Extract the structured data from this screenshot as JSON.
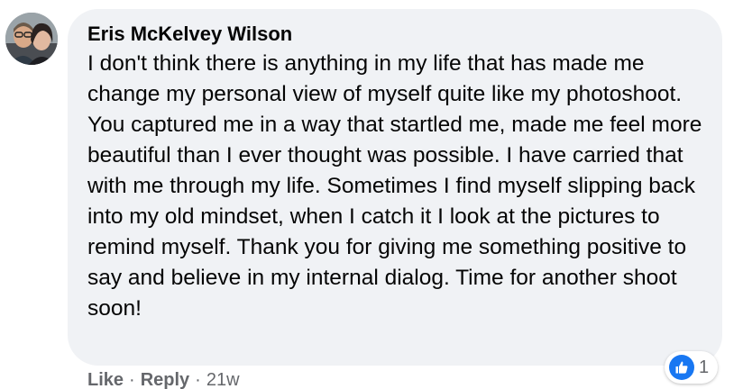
{
  "comment": {
    "author": "Eris McKelvey Wilson",
    "text": "I don't think there is anything in my life that has made me change my personal view of myself quite like my photoshoot. You captured me in a way that startled me, made me feel more beautiful than I ever thought was possible. I have carried that with me through my life. Sometimes I find myself slipping back into my old mindset, when I catch it I look at the pictures to remind myself. Thank you for giving me something positive to say and believe in my internal dialog. Time for another shoot soon!",
    "actions": {
      "like_label": "Like",
      "reply_label": "Reply",
      "separator": "·",
      "timestamp": "21w"
    },
    "reactions": {
      "icon": "thumbs-up-icon",
      "count": "1",
      "color": "#1877f2"
    }
  },
  "colors": {
    "bubble": "#f0f2f5",
    "text": "#050505",
    "secondary_text": "#65676b",
    "like_blue": "#1877f2"
  }
}
